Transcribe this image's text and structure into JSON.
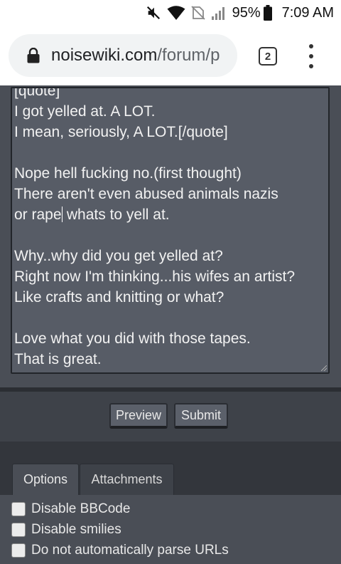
{
  "status_bar": {
    "battery_percent": "95%",
    "time": "7:09 AM",
    "icons": [
      "mute-icon",
      "wifi-icon",
      "no-sim-icon",
      "signal-icon",
      "battery-icon"
    ]
  },
  "browser": {
    "url_domain": "noisewiki.com",
    "url_path": "/forum/p",
    "tab_count": "2"
  },
  "editor": {
    "lines": [
      "[quote]",
      "I got yelled at. A LOT.",
      "I mean, seriously, A LOT.[/quote]",
      "",
      "Nope hell fucking no.(first thought)",
      "There aren't even abused animals nazis",
      "or rape| whats to yell at.",
      "",
      "Why..why did you get yelled at?",
      "Right now I'm thinking...his wifes an artist?",
      "Like crafts and knitting or what?",
      "",
      "Love what you did with those tapes.",
      "That is great."
    ],
    "line_1": "[quote]",
    "line_2": "I got yelled at. A LOT.",
    "line_3": "I mean, seriously, A LOT.[/quote]",
    "line_5": "Nope hell fucking no.(first thought)",
    "line_6": "There aren't even abused animals nazis",
    "line_7a": "or rape",
    "line_7b": " whats to yell at.",
    "line_9": "Why..why did you get yelled at?",
    "line_10": "Right now I'm thinking...his wifes an artist?",
    "line_11": "Like crafts and knitting or what?",
    "line_13": "Love what you did with those tapes.",
    "line_14": "That is great."
  },
  "actions": {
    "preview_label": "Preview",
    "submit_label": "Submit"
  },
  "tabs": {
    "options_label": "Options",
    "attachments_label": "Attachments",
    "active": "Options"
  },
  "options": {
    "disable_bbcode": "Disable BBCode",
    "disable_smilies": "Disable smilies",
    "no_parse_urls": "Do not automatically parse URLs"
  },
  "colors": {
    "page_background": "#3e4249",
    "editor_background": "#575c66",
    "text": "#f2f2f2"
  }
}
